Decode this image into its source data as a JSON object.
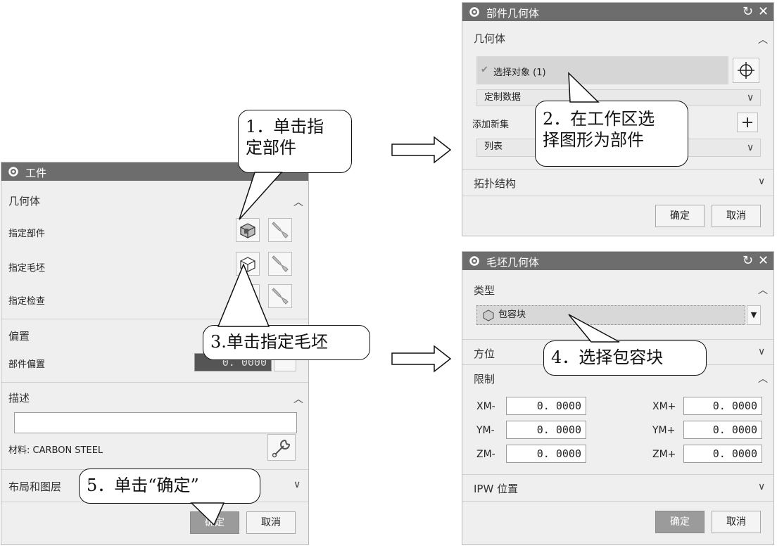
{
  "workpiece_dialog": {
    "title": "工件",
    "geometry": {
      "header": "几何体",
      "specify_part": "指定部件",
      "specify_blank": "指定毛坯",
      "specify_check": "指定检查"
    },
    "offset": {
      "header": "偏置",
      "part_offset_label": "部件偏置",
      "part_offset_value": "0. 0000"
    },
    "description": {
      "header": "描述",
      "text_value": "",
      "material_label": "材料: CARBON STEEL"
    },
    "layout": {
      "header": "布局和图层"
    },
    "ok_label": "确定",
    "cancel_label": "取消"
  },
  "part_geometry_dialog": {
    "title": "部件几何体",
    "geometry": {
      "header": "几何体",
      "select_object": "选择对象 (1)",
      "custom_data": "定制数据",
      "add_new_set": "添加新集",
      "list": "列表"
    },
    "topology": {
      "header": "拓扑结构"
    },
    "ok_label": "确定",
    "cancel_label": "取消"
  },
  "blank_geometry_dialog": {
    "title": "毛坯几何体",
    "type": {
      "header": "类型",
      "selected": "包容块"
    },
    "orientation": {
      "header": "方位"
    },
    "limits": {
      "header": "限制",
      "xm_label": "XM-",
      "xm_value": "0. 0000",
      "xp_label": "XM+",
      "xp_value": "0. 0000",
      "ym_label": "YM-",
      "ym_value": "0. 0000",
      "yp_label": "YM+",
      "yp_value": "0. 0000",
      "zm_label": "ZM-",
      "zm_value": "0. 0000",
      "zp_label": "ZM+",
      "zp_value": "0. 0000"
    },
    "ipw": {
      "header": "IPW 位置"
    },
    "ok_label": "确定",
    "cancel_label": "取消"
  },
  "callouts": {
    "step1_line1": "1．单击指",
    "step1_line2": "定部件",
    "step2_line1": "2．在工作区选",
    "step2_line2": "择图形为部件",
    "step3": "3.单击指定毛坯",
    "step4": "4．选择包容块",
    "step5": "5．单击“确定”"
  },
  "colors": {
    "title_bar": "#6d6d6d",
    "dialog_bg": "#efefef",
    "default_button": "#9b9b9b"
  }
}
